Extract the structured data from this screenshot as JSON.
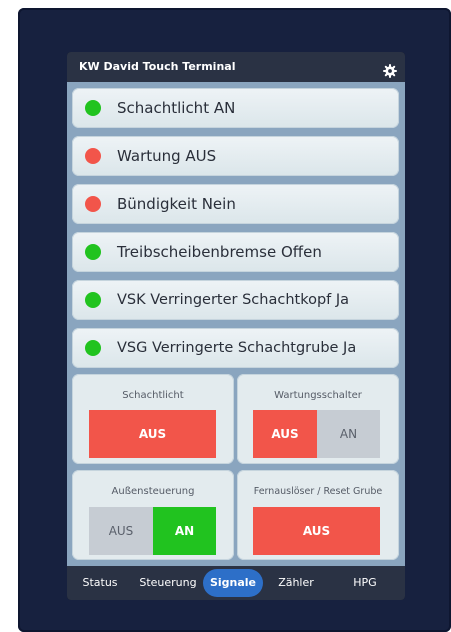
{
  "window": {
    "title": "KW David Touch Terminal",
    "settings_icon": "gear-icon"
  },
  "colors": {
    "green": "#21c31f",
    "red": "#f2554a",
    "nav_active": "#2d6fc8"
  },
  "signals": [
    {
      "label": "Schachtlicht AN",
      "status": "green"
    },
    {
      "label": "Wartung AUS",
      "status": "red"
    },
    {
      "label": "Bündigkeit Nein",
      "status": "red"
    },
    {
      "label": "Treibscheibenbremse Offen",
      "status": "green"
    },
    {
      "label": "VSK Verringerter Schachtkopf Ja",
      "status": "green"
    },
    {
      "label": "VSG Verringerte Schachtgrube Ja",
      "status": "green"
    }
  ],
  "panels": {
    "schachtlicht": {
      "title": "Schachtlicht",
      "button": "AUS"
    },
    "wartungsschalter": {
      "title": "Wartungsschalter",
      "off": "AUS",
      "on": "AN",
      "active": "AUS"
    },
    "aussensteuerung": {
      "title": "Außensteuerung",
      "off": "AUS",
      "on": "AN",
      "active": "AN"
    },
    "fernausloeser": {
      "title": "Fernauslöser / Reset Grube",
      "button": "AUS"
    }
  },
  "nav": {
    "items": [
      "Status",
      "Steuerung",
      "Signale",
      "Zähler",
      "HPG"
    ],
    "active": "Signale"
  }
}
